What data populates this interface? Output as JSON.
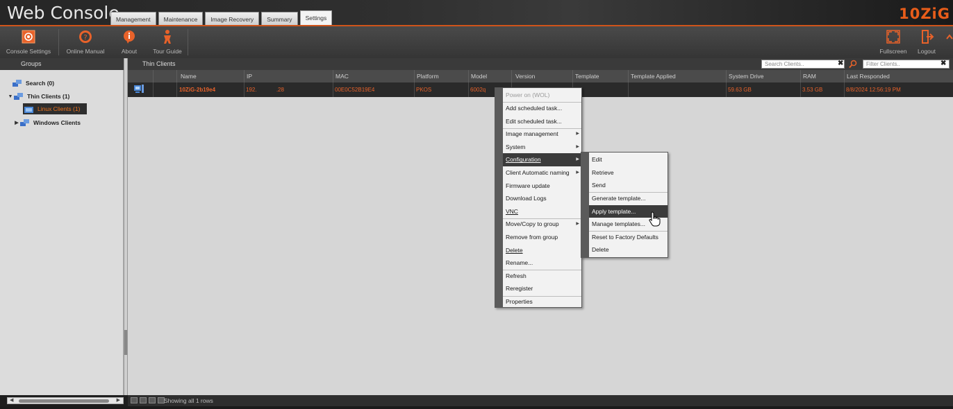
{
  "app": {
    "title": "Web Console",
    "brand": "10ZiG",
    "tabs": [
      "Management",
      "Maintenance",
      "Image Recovery",
      "Summary",
      "Settings"
    ],
    "active_tab": "Settings"
  },
  "toolbar": {
    "items": [
      "Console Settings",
      "Online Manual",
      "About",
      "Tour Guide"
    ],
    "right_items": [
      "Fullscreen",
      "Logout"
    ]
  },
  "groups": {
    "title": "Groups",
    "search": "Search (0)",
    "thin_clients": "Thin Clients (1)",
    "linux_clients": "Linux Clients (1)",
    "windows_clients": "Windows Clients"
  },
  "clients": {
    "title": "Thin Clients",
    "search_placeholder": "Search Clients..",
    "filter_placeholder": "Filter Clients..",
    "columns": [
      "Name",
      "IP",
      "MAC",
      "Platform",
      "Model",
      "Version",
      "Template",
      "Template Applied",
      "System Drive",
      "RAM",
      "Last Responded"
    ],
    "rows": [
      {
        "name": "10ZiG-2b19e4",
        "ip_a": "192.",
        "ip_b": ".28",
        "mac": "00E0C52B19E4",
        "platform": "PKOS",
        "model": "6002q",
        "system_drive": "59.63 GB",
        "ram": "3.53 GB",
        "last_responded": "8/8/2024 12:56:19 PM"
      }
    ],
    "status": "Showing all 1 rows"
  },
  "context_menu": {
    "items": [
      "Power on (WOL)",
      "Add scheduled task...",
      "Edit scheduled task...",
      "Image management",
      "System",
      "Configuration",
      "Client Automatic naming",
      "Firmware update",
      "Download Logs",
      "VNC",
      "Move/Copy to group",
      "Remove from group",
      "Delete",
      "Rename...",
      "Refresh",
      "Reregister",
      "Properties"
    ]
  },
  "config_submenu": {
    "items": [
      "Edit",
      "Retrieve",
      "Send",
      "Generate template...",
      "Apply template...",
      "Manage templates...",
      "Reset to Factory Defaults",
      "Delete"
    ]
  },
  "colors": {
    "accent": "#e8622a",
    "dark": "#2a2a2a"
  }
}
